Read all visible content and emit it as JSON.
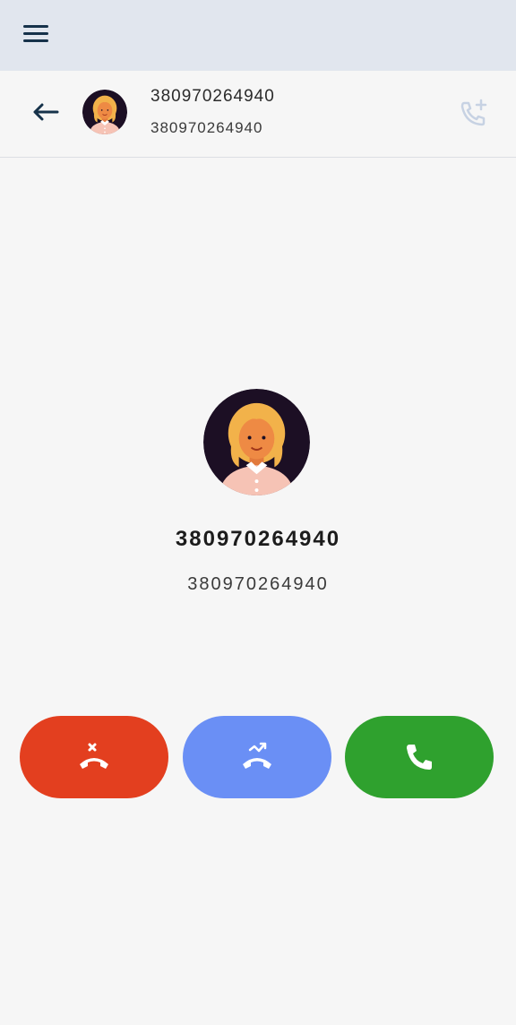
{
  "caller": {
    "name": "380970264940",
    "number": "380970264940"
  },
  "icons": {
    "menu": "menu-icon",
    "back": "arrow-left-icon",
    "add_call": "phone-plus-icon",
    "decline": "phone-hangup-x-icon",
    "redirect": "phone-forward-icon",
    "accept": "phone-icon"
  },
  "colors": {
    "topbar": "#e1e6ee",
    "decline": "#e33f1f",
    "redirect": "#6a8ff5",
    "accept": "#2fa12e",
    "icon_dark": "#16324a"
  }
}
